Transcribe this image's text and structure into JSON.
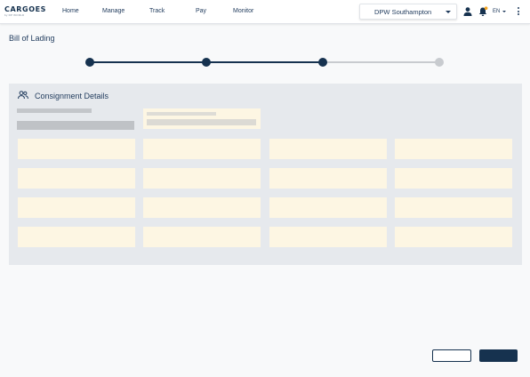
{
  "header": {
    "logo_text": "CARGOES",
    "logo_sub": "by DP WORLD",
    "nav": [
      {
        "label": "Home"
      },
      {
        "label": "Manage"
      },
      {
        "label": "Track"
      },
      {
        "label": "Pay"
      },
      {
        "label": "Monitor"
      }
    ],
    "location": "DPW Southampton",
    "language": "EN",
    "icons": [
      "user-icon",
      "bell-icon",
      "more-vertical-icon"
    ],
    "notification_dot_color": "#f5a623"
  },
  "page": {
    "title": "Bill of Lading"
  },
  "stepper": {
    "total_steps": 4,
    "completed_steps": 3,
    "active_color": "#16324f",
    "inactive_color": "#c8cbcf"
  },
  "consignment": {
    "title": "Consignment Details",
    "icon": "people-icon",
    "field_color": "#fdf6e3"
  }
}
